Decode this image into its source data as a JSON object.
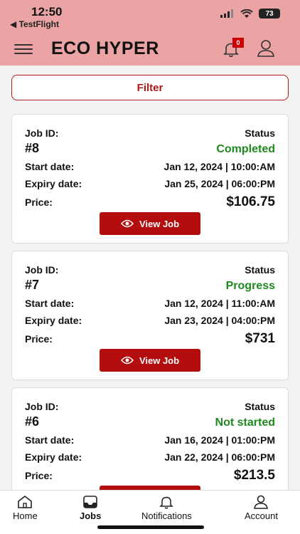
{
  "status_bar": {
    "time": "12:50",
    "back_app": "◀ TestFlight",
    "battery": "73"
  },
  "header": {
    "title": "ECO HYPER",
    "notification_count": "0"
  },
  "filter": {
    "label": "Filter"
  },
  "labels": {
    "job_id": "Job ID:",
    "status": "Status",
    "start_date": "Start date:",
    "expiry_date": "Expiry date:",
    "price": "Price:",
    "view_job": "View Job"
  },
  "jobs": [
    {
      "id": "#8",
      "status": "Completed",
      "start": "Jan 12, 2024 | 10:00:AM",
      "expiry": "Jan 25, 2024 | 06:00:PM",
      "price": "$106.75"
    },
    {
      "id": "#7",
      "status": "Progress",
      "start": "Jan 12, 2024 | 11:00:AM",
      "expiry": "Jan 23, 2024 | 04:00:PM",
      "price": "$731"
    },
    {
      "id": "#6",
      "status": "Not started",
      "start": "Jan 16, 2024 | 01:00:PM",
      "expiry": "Jan 22, 2024 | 06:00:PM",
      "price": "$213.5"
    }
  ],
  "nav": {
    "home": "Home",
    "jobs": "Jobs",
    "notifications": "Notifications",
    "account": "Account"
  },
  "colors": {
    "header": "#eba3a3",
    "accent": "#b30d0d",
    "status_green": "#1e8a1e"
  }
}
